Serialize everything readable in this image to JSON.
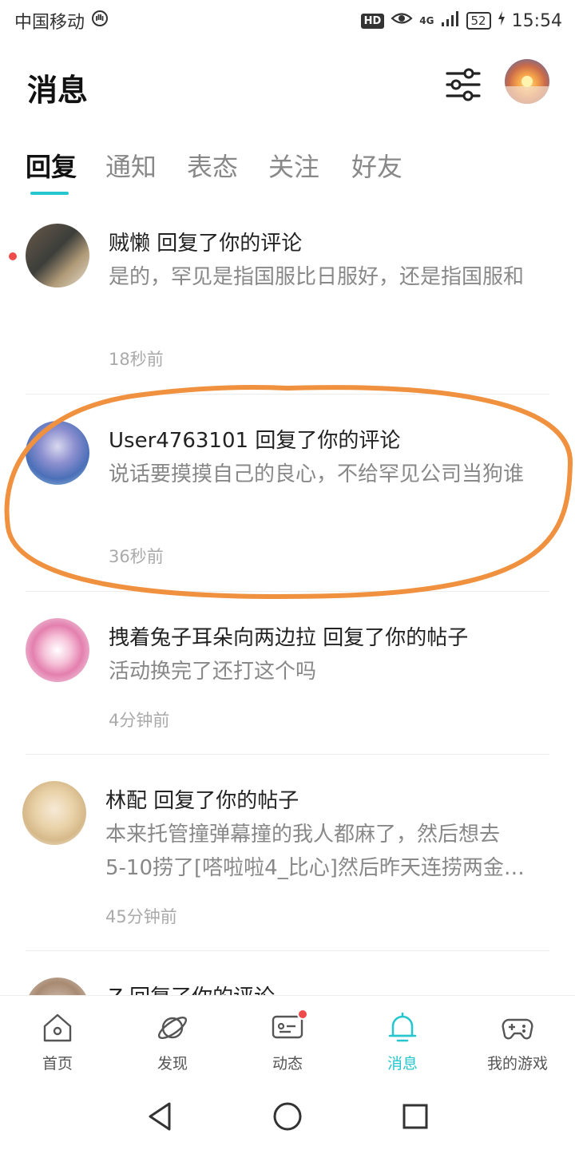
{
  "status_bar": {
    "carrier": "中国移动",
    "hd": "HD",
    "network": "4G",
    "battery": "52",
    "time": "15:54"
  },
  "header": {
    "title": "消息",
    "filter_icon": "sliders-icon",
    "avatar_icon": "profile-avatar"
  },
  "tabs": [
    {
      "label": "回复",
      "active": true
    },
    {
      "label": "通知",
      "active": false
    },
    {
      "label": "表态",
      "active": false
    },
    {
      "label": "关注",
      "active": false
    },
    {
      "label": "好友",
      "active": false
    }
  ],
  "messages": [
    {
      "user": "贼懒",
      "action": "回复了你的评论",
      "body": "是的，罕见是指国服比日服好，还是指国服和",
      "time": "18秒前",
      "unread": true
    },
    {
      "user": "User4763101",
      "action": "回复了你的评论",
      "body": "说话要摸摸自己的良心，不给罕见公司当狗谁",
      "time": "36秒前",
      "unread": false
    },
    {
      "user": "拽着兔子耳朵向两边拉",
      "action": "回复了你的帖子",
      "body": "活动换完了还打这个吗",
      "time": "4分钟前",
      "unread": false
    },
    {
      "user": "林配",
      "action": "回复了你的帖子",
      "body_line1": "本来托管撞弹幕撞的我人都麻了，然后想去",
      "body_line2": "5-10捞了[嗒啦啦4_比心]然后昨天连捞两金…",
      "time": "45分钟前",
      "unread": false
    },
    {
      "user": "Z",
      "action": "回复了你的评论",
      "unread": false
    }
  ],
  "bottom_nav": [
    {
      "label": "首页",
      "icon": "home-icon",
      "active": false
    },
    {
      "label": "发现",
      "icon": "planet-icon",
      "active": false
    },
    {
      "label": "动态",
      "icon": "chat-icon",
      "active": false,
      "badge": true
    },
    {
      "label": "消息",
      "icon": "bell-icon",
      "active": true
    },
    {
      "label": "我的游戏",
      "icon": "gamepad-icon",
      "active": false
    }
  ],
  "colors": {
    "accent": "#26c6cf",
    "unread": "#f04b4b",
    "annotation": "#f0913f"
  }
}
